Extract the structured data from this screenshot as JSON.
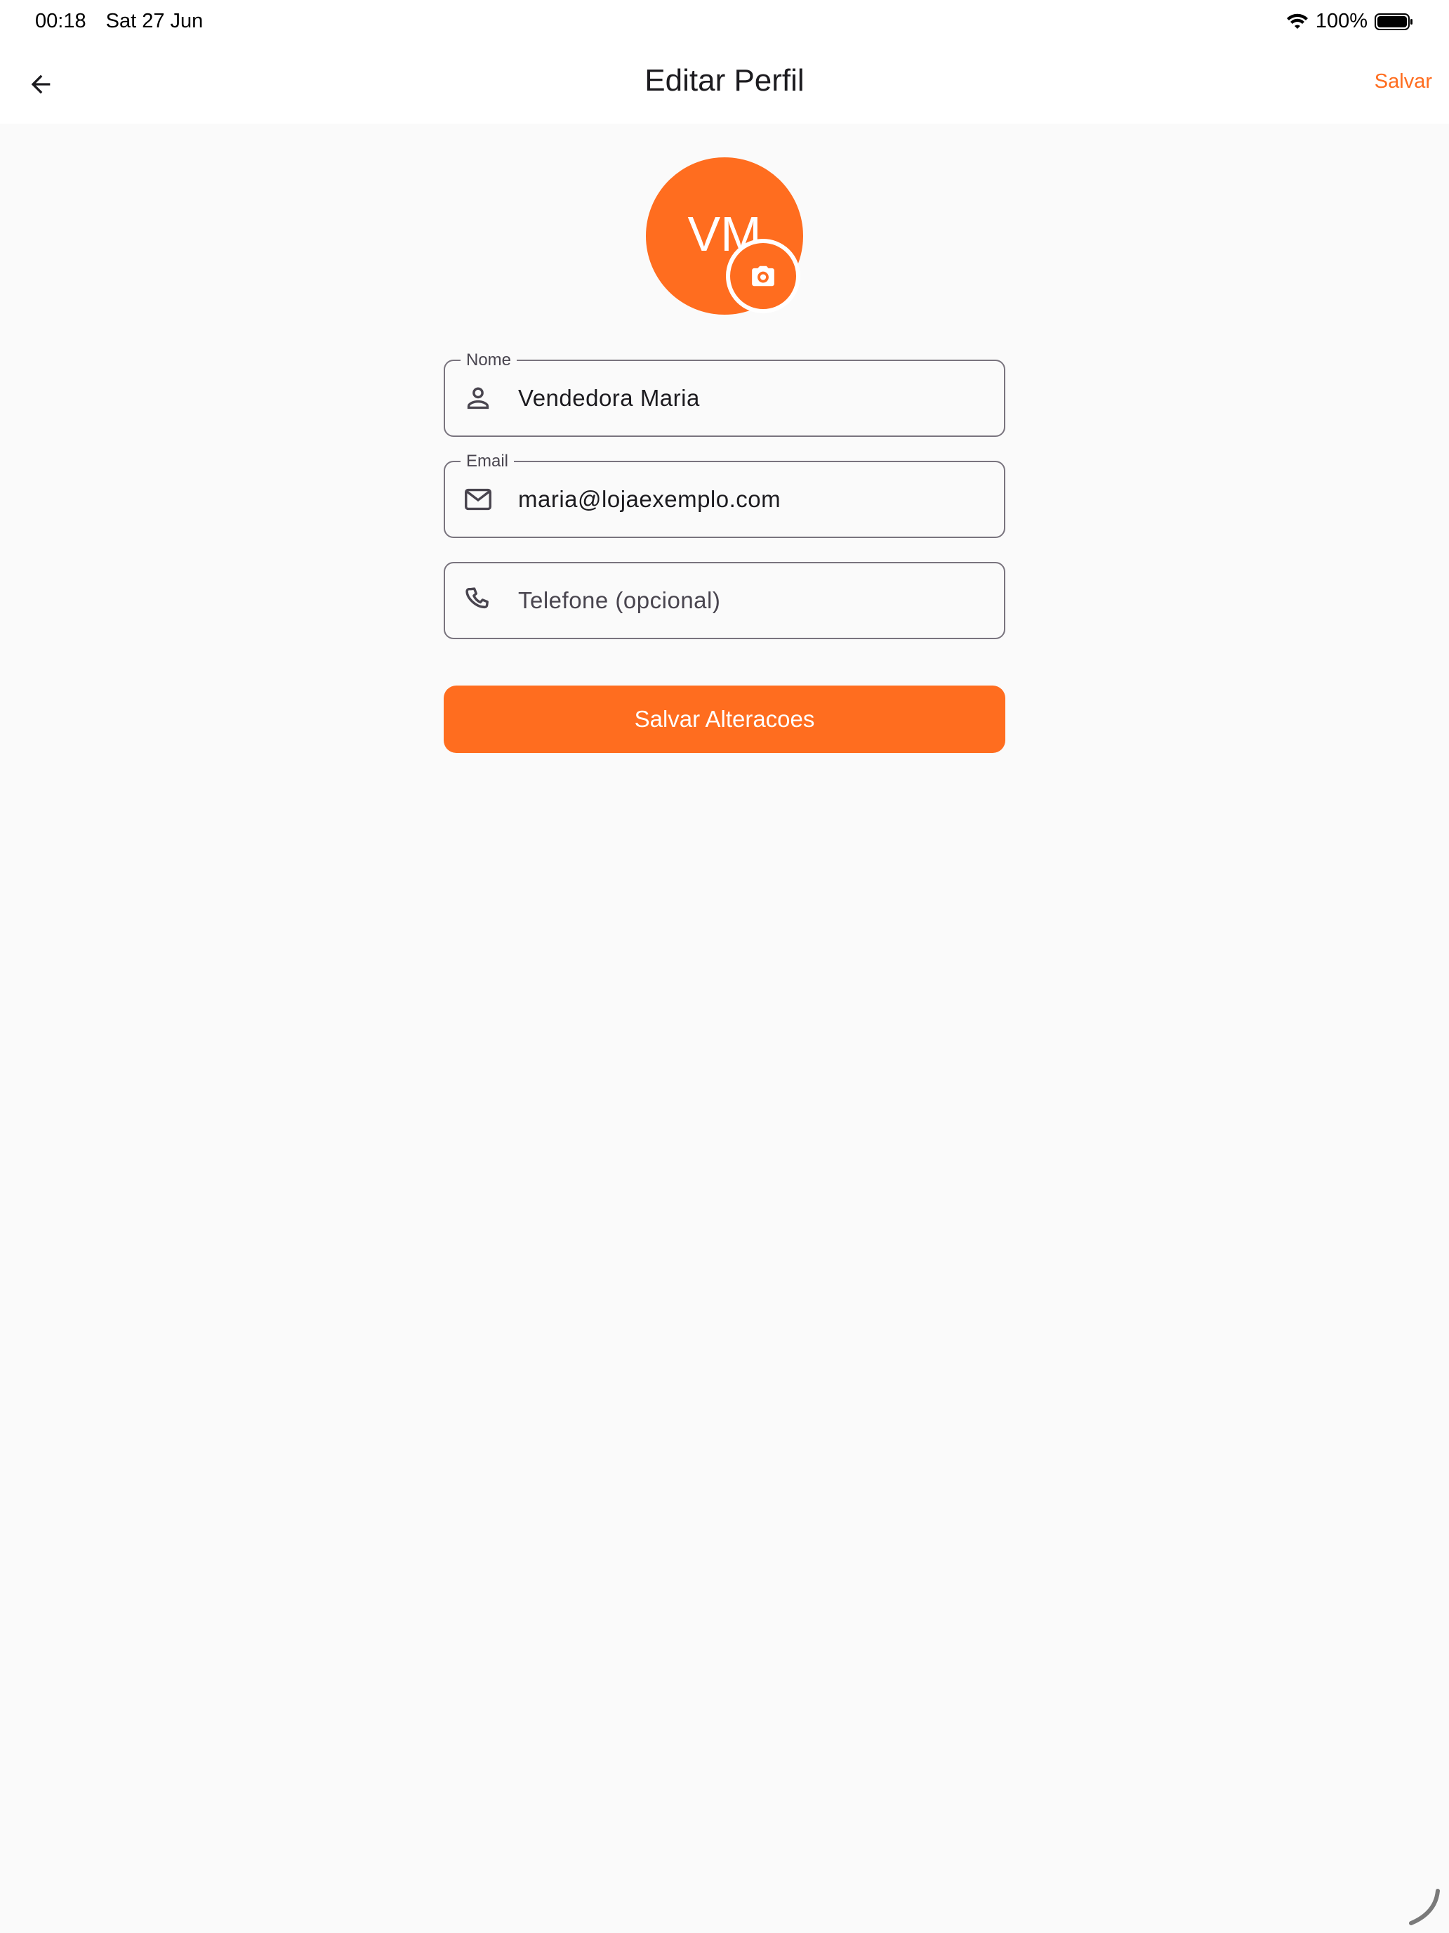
{
  "status_bar": {
    "time": "00:18",
    "date": "Sat 27 Jun",
    "battery": "100%"
  },
  "app_bar": {
    "title": "Editar Perfil",
    "save_label": "Salvar"
  },
  "avatar": {
    "initials": "VM"
  },
  "form": {
    "name": {
      "label": "Nome",
      "value": "Vendedora Maria"
    },
    "email": {
      "label": "Email",
      "value": "maria@lojaexemplo.com"
    },
    "phone": {
      "placeholder": "Telefone (opcional)",
      "value": ""
    },
    "submit_label": "Salvar Alteracoes"
  },
  "colors": {
    "accent": "#ff6d1f",
    "background": "#fafafa",
    "outline": "#79747e"
  },
  "icons": {
    "back": "arrow-back-icon",
    "camera": "camera-icon",
    "name": "person-icon",
    "email": "mail-icon",
    "phone": "phone-icon"
  }
}
